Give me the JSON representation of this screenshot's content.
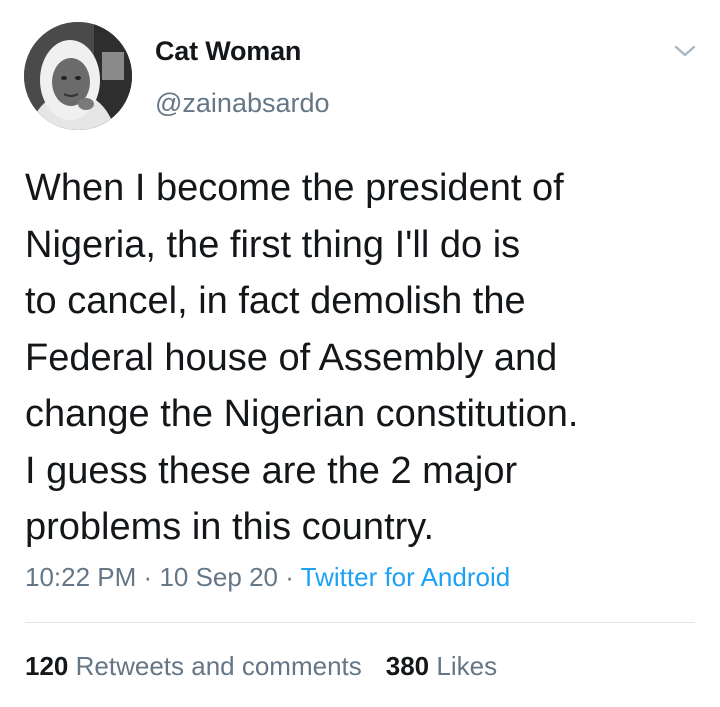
{
  "tweet": {
    "author": {
      "display_name": "Cat Woman",
      "handle": "@zainabsardo",
      "avatar_icon": "profile-photo"
    },
    "menu_icon": "chevron-down-icon",
    "text_lines": [
      "When I become the president of",
      "Nigeria, the first thing I'll do is",
      "to cancel, in fact demolish the",
      "Federal house of Assembly and",
      "change the Nigerian constitution.",
      "I guess these are the 2 major",
      "problems in this country."
    ],
    "time": "10:22 PM",
    "separator": "·",
    "date": "10 Sep 20",
    "source": "Twitter for Android",
    "stats": {
      "retweets_count": "120",
      "retweets_label": "Retweets and comments",
      "likes_count": "380",
      "likes_label": "Likes"
    }
  },
  "colors": {
    "text_primary": "#14171a",
    "text_secondary": "#657786",
    "link": "#1da1f2",
    "divider": "#e1e8ed"
  }
}
